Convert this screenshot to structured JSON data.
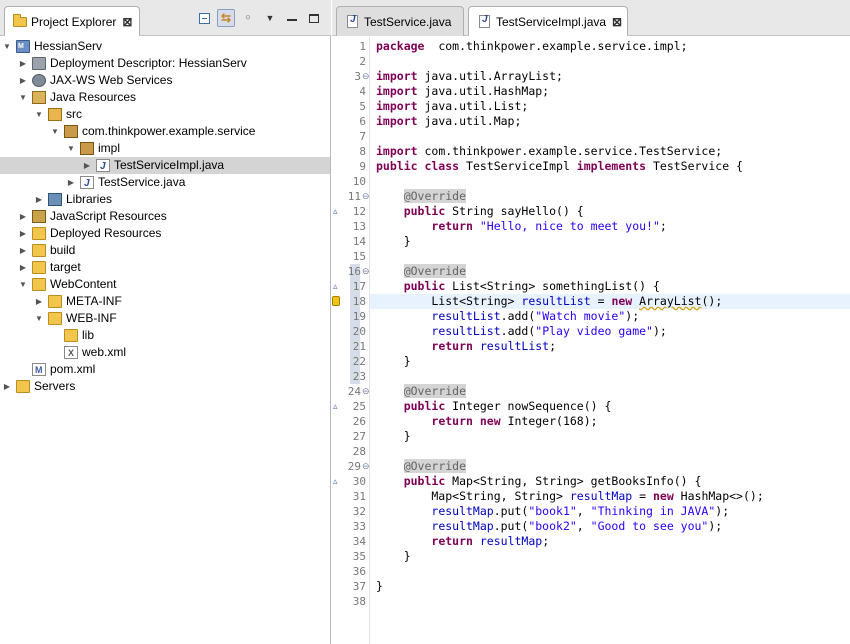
{
  "explorer": {
    "tab_label": "Project Explorer",
    "tab_close": "⊠",
    "tree": [
      {
        "label": "HessianServ",
        "icon": "maven-project-icon",
        "twisty": "▼",
        "selected": false
      },
      {
        "label": "Deployment Descriptor: HessianServ",
        "icon": "deployment-descriptor-icon",
        "twisty": "▶",
        "selected": false
      },
      {
        "label": "JAX-WS Web Services",
        "icon": "web-services-icon",
        "twisty": "▶",
        "selected": false
      },
      {
        "label": "Java Resources",
        "icon": "java-resources-icon",
        "twisty": "▼",
        "selected": false
      },
      {
        "label": "src",
        "icon": "source-folder-icon",
        "twisty": "▼",
        "selected": false
      },
      {
        "label": "com.thinkpower.example.service",
        "icon": "package-icon",
        "twisty": "▼",
        "selected": false
      },
      {
        "label": "impl",
        "icon": "package-icon",
        "twisty": "▼",
        "selected": false
      },
      {
        "label": "TestServiceImpl.java",
        "icon": "java-file-icon",
        "twisty": "▶",
        "selected": true
      },
      {
        "label": "TestService.java",
        "icon": "java-file-icon",
        "twisty": "▶",
        "selected": false
      },
      {
        "label": "Libraries",
        "icon": "libraries-icon",
        "twisty": "▶",
        "selected": false
      },
      {
        "label": "JavaScript Resources",
        "icon": "javascript-resources-icon",
        "twisty": "▶",
        "selected": false
      },
      {
        "label": "Deployed Resources",
        "icon": "folder-icon",
        "twisty": "▶",
        "selected": false
      },
      {
        "label": "build",
        "icon": "folder-icon",
        "twisty": "▶",
        "selected": false
      },
      {
        "label": "target",
        "icon": "folder-icon",
        "twisty": "▶",
        "selected": false
      },
      {
        "label": "WebContent",
        "icon": "folder-icon",
        "twisty": "▼",
        "selected": false
      },
      {
        "label": "META-INF",
        "icon": "folder-icon",
        "twisty": "▶",
        "selected": false
      },
      {
        "label": "WEB-INF",
        "icon": "folder-icon",
        "twisty": "▼",
        "selected": false
      },
      {
        "label": "lib",
        "icon": "folder-icon",
        "twisty": "",
        "selected": false
      },
      {
        "label": "web.xml",
        "icon": "xml-file-icon",
        "twisty": "",
        "selected": false
      },
      {
        "label": "pom.xml",
        "icon": "maven-pom-icon",
        "twisty": "",
        "selected": false
      },
      {
        "label": "Servers",
        "icon": "folder-icon",
        "twisty": "▶",
        "selected": false
      }
    ]
  },
  "editor": {
    "tabs": [
      {
        "label": "TestService.java",
        "active": false
      },
      {
        "label": "TestServiceImpl.java",
        "active": true,
        "close": "⊠"
      }
    ],
    "current_line": 18,
    "lines": [
      {
        "n": "1",
        "tokens": [
          [
            "kw",
            "package"
          ],
          [
            "",
            "  com.thinkpower.example.service.impl;"
          ]
        ]
      },
      {
        "n": "2",
        "tokens": []
      },
      {
        "n": "3",
        "fold": "⊖",
        "tokens": [
          [
            "kw",
            "import"
          ],
          [
            "",
            " java.util.ArrayList;"
          ]
        ]
      },
      {
        "n": "4",
        "tokens": [
          [
            "kw",
            "import"
          ],
          [
            "",
            " java.util.HashMap;"
          ]
        ]
      },
      {
        "n": "5",
        "tokens": [
          [
            "kw",
            "import"
          ],
          [
            "",
            " java.util.List;"
          ]
        ]
      },
      {
        "n": "6",
        "tokens": [
          [
            "kw",
            "import"
          ],
          [
            "",
            " java.util.Map;"
          ]
        ]
      },
      {
        "n": "7",
        "tokens": []
      },
      {
        "n": "8",
        "tokens": [
          [
            "kw",
            "import"
          ],
          [
            "",
            " com.thinkpower.example.service.TestService;"
          ]
        ]
      },
      {
        "n": "9",
        "tokens": [
          [
            "kw",
            "public class"
          ],
          [
            "",
            " TestServiceImpl "
          ],
          [
            "kw",
            "implements"
          ],
          [
            "",
            " TestService {"
          ]
        ]
      },
      {
        "n": "10",
        "tokens": []
      },
      {
        "n": "11",
        "fold": "⊖",
        "tokens": [
          [
            "",
            "    "
          ],
          [
            "ann",
            "@Override"
          ]
        ]
      },
      {
        "n": "12",
        "marker": "triangle",
        "tokens": [
          [
            "",
            "    "
          ],
          [
            "kw",
            "public"
          ],
          [
            "",
            " String sayHello() {"
          ]
        ]
      },
      {
        "n": "13",
        "tokens": [
          [
            "",
            "        "
          ],
          [
            "kw",
            "return"
          ],
          [
            "",
            " "
          ],
          [
            "str",
            "\"Hello, nice to meet you!\""
          ],
          [
            "",
            ";"
          ]
        ]
      },
      {
        "n": "14",
        "tokens": [
          [
            "",
            "    }"
          ]
        ]
      },
      {
        "n": "15",
        "tokens": []
      },
      {
        "n": "16",
        "fold": "⊖",
        "tokens": [
          [
            "",
            "    "
          ],
          [
            "ann",
            "@Override"
          ]
        ]
      },
      {
        "n": "17",
        "marker": "triangle",
        "tokens": [
          [
            "",
            "    "
          ],
          [
            "kw",
            "public"
          ],
          [
            "",
            " List<String> somethingList() {"
          ]
        ]
      },
      {
        "n": "18",
        "marker": "warning",
        "tokens": [
          [
            "",
            "        List<String> "
          ],
          [
            "var",
            "resultList"
          ],
          [
            "",
            " = "
          ],
          [
            "kw",
            "new"
          ],
          [
            "",
            " "
          ],
          [
            "sq",
            "ArrayList"
          ],
          [
            "",
            "();"
          ]
        ]
      },
      {
        "n": "19",
        "tokens": [
          [
            "",
            "        "
          ],
          [
            "var",
            "resultList"
          ],
          [
            "",
            ".add("
          ],
          [
            "str",
            "\"Watch movie\""
          ],
          [
            "",
            ");"
          ]
        ]
      },
      {
        "n": "20",
        "tokens": [
          [
            "",
            "        "
          ],
          [
            "var",
            "resultList"
          ],
          [
            "",
            ".add("
          ],
          [
            "str",
            "\"Play video game\""
          ],
          [
            "",
            ");"
          ]
        ]
      },
      {
        "n": "21",
        "tokens": [
          [
            "",
            "        "
          ],
          [
            "kw",
            "return"
          ],
          [
            "",
            " "
          ],
          [
            "var",
            "resultList"
          ],
          [
            "",
            ";"
          ]
        ]
      },
      {
        "n": "22",
        "tokens": [
          [
            "",
            "    }"
          ]
        ]
      },
      {
        "n": "23",
        "tokens": []
      },
      {
        "n": "24",
        "fold": "⊖",
        "tokens": [
          [
            "",
            "    "
          ],
          [
            "ann",
            "@Override"
          ]
        ]
      },
      {
        "n": "25",
        "marker": "triangle",
        "tokens": [
          [
            "",
            "    "
          ],
          [
            "kw",
            "public"
          ],
          [
            "",
            " Integer nowSequence() {"
          ]
        ]
      },
      {
        "n": "26",
        "tokens": [
          [
            "",
            "        "
          ],
          [
            "kw",
            "return new"
          ],
          [
            "",
            " Integer(168);"
          ]
        ]
      },
      {
        "n": "27",
        "tokens": [
          [
            "",
            "    }"
          ]
        ]
      },
      {
        "n": "28",
        "tokens": []
      },
      {
        "n": "29",
        "fold": "⊖",
        "tokens": [
          [
            "",
            "    "
          ],
          [
            "ann",
            "@Override"
          ]
        ]
      },
      {
        "n": "30",
        "marker": "triangle",
        "tokens": [
          [
            "",
            "    "
          ],
          [
            "kw",
            "public"
          ],
          [
            "",
            " Map<String, String> getBooksInfo() {"
          ]
        ]
      },
      {
        "n": "31",
        "tokens": [
          [
            "",
            "        Map<String, String> "
          ],
          [
            "var",
            "resultMap"
          ],
          [
            "",
            " = "
          ],
          [
            "kw",
            "new"
          ],
          [
            "",
            " HashMap<>();"
          ]
        ]
      },
      {
        "n": "32",
        "tokens": [
          [
            "",
            "        "
          ],
          [
            "var",
            "resultMap"
          ],
          [
            "",
            ".put("
          ],
          [
            "str",
            "\"book1\""
          ],
          [
            "",
            ", "
          ],
          [
            "str",
            "\"Thinking in JAVA\""
          ],
          [
            "",
            ");"
          ]
        ]
      },
      {
        "n": "33",
        "tokens": [
          [
            "",
            "        "
          ],
          [
            "var",
            "resultMap"
          ],
          [
            "",
            ".put("
          ],
          [
            "str",
            "\"book2\""
          ],
          [
            "",
            ", "
          ],
          [
            "str",
            "\"Good to see you\""
          ],
          [
            "",
            ");"
          ]
        ]
      },
      {
        "n": "34",
        "tokens": [
          [
            "",
            "        "
          ],
          [
            "kw",
            "return"
          ],
          [
            "",
            " "
          ],
          [
            "var",
            "resultMap"
          ],
          [
            "",
            ";"
          ]
        ]
      },
      {
        "n": "35",
        "tokens": [
          [
            "",
            "    }"
          ]
        ]
      },
      {
        "n": "36",
        "tokens": []
      },
      {
        "n": "37",
        "tokens": [
          [
            "",
            "}"
          ]
        ]
      },
      {
        "n": "38",
        "tokens": []
      }
    ]
  }
}
